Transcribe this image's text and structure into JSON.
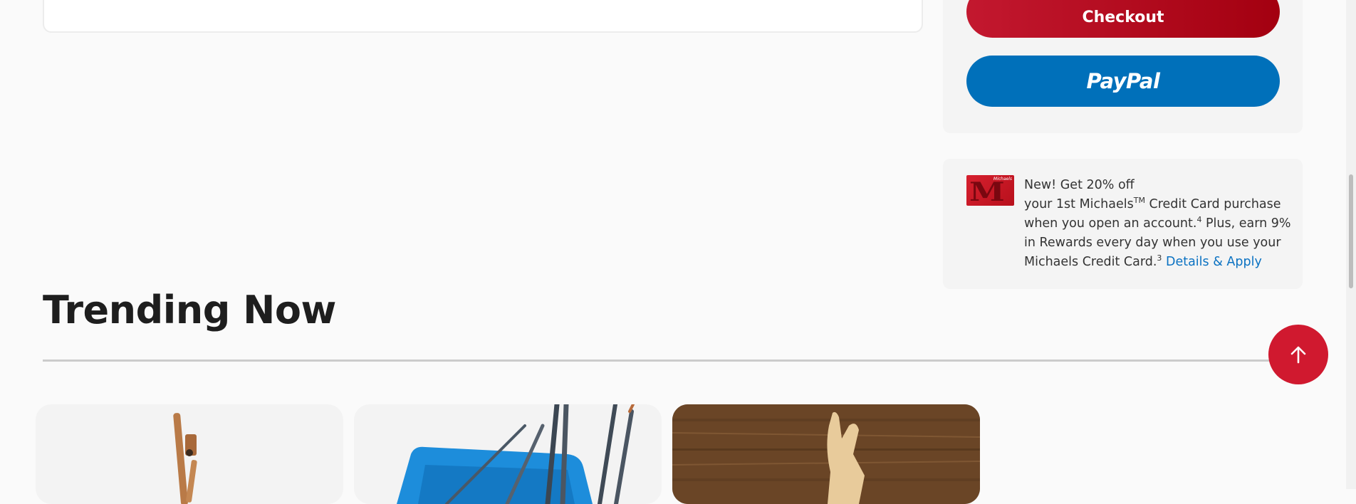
{
  "cart_summary": {
    "checkout_label": "Checkout",
    "paypal_label": "PayPal"
  },
  "promo": {
    "line1": "New! Get 20% off",
    "line2": "your 1st Michaels",
    "tm": "TM",
    "line2b": " Credit Card purchase",
    "line3": "when you open an account.",
    "sup1": "4",
    "line3b": " Plus, earn 9%",
    "line4": "in Rewards every day when you use your",
    "line5": "Michaels Credit Card.",
    "sup2": "3",
    "link_label": "Details & Apply",
    "card_brand": "Michaels",
    "card_letter": "M"
  },
  "trending": {
    "title": "Trending Now"
  },
  "icons": {
    "back_to_top": "arrow-up-icon"
  },
  "colors": {
    "checkout": "#c3182f",
    "paypal": "#0070ba",
    "link": "#0b72c2",
    "back_to_top": "#d0192f"
  }
}
